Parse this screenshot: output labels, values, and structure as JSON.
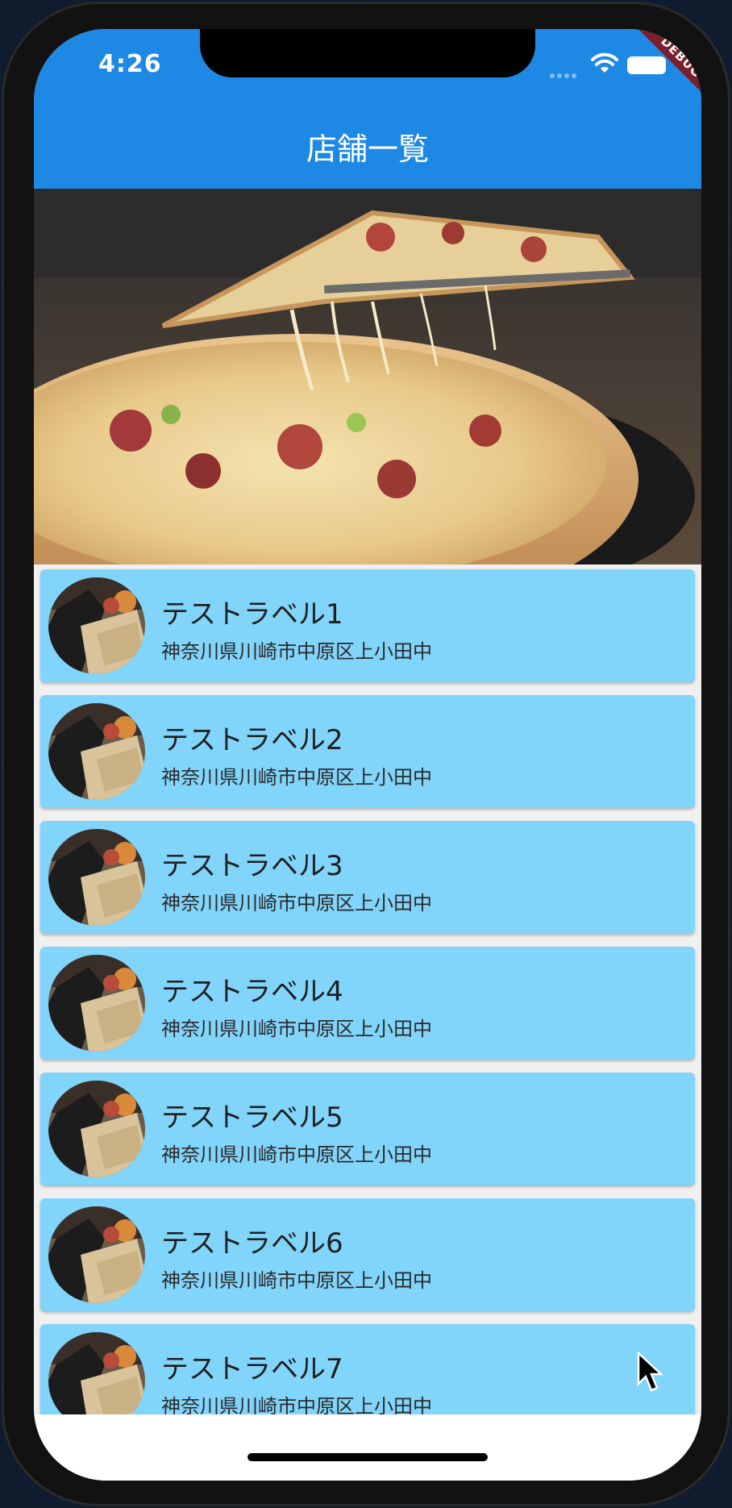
{
  "status_bar": {
    "time": "4:26",
    "debug_label": "DEBUG"
  },
  "app_bar": {
    "title": "店舗一覧"
  },
  "hero": {
    "image": "pizza-photo"
  },
  "stores": [
    {
      "name": "テストラベル1",
      "address": "神奈川県川崎市中原区上小田中"
    },
    {
      "name": "テストラベル2",
      "address": "神奈川県川崎市中原区上小田中"
    },
    {
      "name": "テストラベル3",
      "address": "神奈川県川崎市中原区上小田中"
    },
    {
      "name": "テストラベル4",
      "address": "神奈川県川崎市中原区上小田中"
    },
    {
      "name": "テストラベル5",
      "address": "神奈川県川崎市中原区上小田中"
    },
    {
      "name": "テストラベル6",
      "address": "神奈川県川崎市中原区上小田中"
    },
    {
      "name": "テストラベル7",
      "address": "神奈川県川崎市中原区上小田中"
    }
  ],
  "colors": {
    "app_bar": "#1e88e5",
    "card": "#81d4fa",
    "list_background": "#f0f0f0",
    "debug_banner": "#7b1e2e"
  },
  "icons": {
    "wifi": "wifi-icon",
    "battery": "battery-icon",
    "signal": "signal-icon",
    "cursor": "mouse-cursor-icon"
  }
}
